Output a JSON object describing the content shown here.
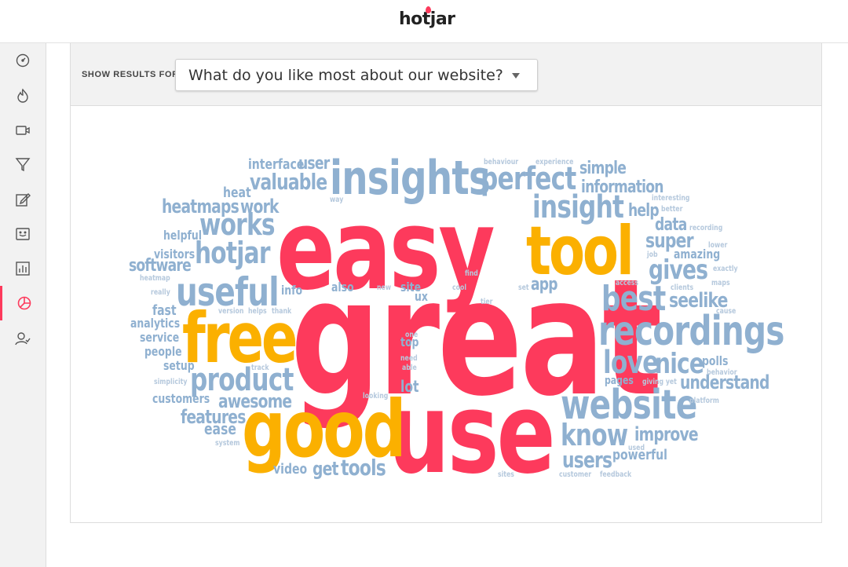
{
  "app": {
    "logo_text": "hotjar"
  },
  "sidebar": {
    "items": [
      {
        "name": "dashboard",
        "icon": "dashboard-gauge-icon",
        "active": false
      },
      {
        "name": "heatmaps",
        "icon": "flame-icon",
        "active": false
      },
      {
        "name": "recordings",
        "icon": "video-camera-icon",
        "active": false
      },
      {
        "name": "funnels",
        "icon": "funnel-icon",
        "active": false
      },
      {
        "name": "forms",
        "icon": "edit-form-icon",
        "active": false
      },
      {
        "name": "feedback",
        "icon": "feedback-face-icon",
        "active": false
      },
      {
        "name": "polls",
        "icon": "bar-chart-icon",
        "active": false
      },
      {
        "name": "surveys",
        "icon": "pie-chart-icon",
        "active": true
      },
      {
        "name": "recruiters",
        "icon": "user-check-icon",
        "active": false
      }
    ]
  },
  "filter": {
    "label": "SHOW RESULTS FOR:",
    "selected_question": "What do you like most about our website?"
  },
  "colors": {
    "accent": "#fd3a5c",
    "pink": "#fd3a5c",
    "orange": "#fbb000",
    "blue": "#8fb0d0",
    "lightblue": "#b6c9dd"
  },
  "word_cloud": {
    "words": [
      {
        "text": "great",
        "c": "pink"
      },
      {
        "text": "easy",
        "c": "pink"
      },
      {
        "text": "use",
        "c": "pink"
      },
      {
        "text": "good",
        "c": "orange"
      },
      {
        "text": "free",
        "c": "orange"
      },
      {
        "text": "tool",
        "c": "orange"
      },
      {
        "text": "insights",
        "c": "blue"
      },
      {
        "text": "perfect",
        "c": "blue"
      },
      {
        "text": "insight",
        "c": "blue"
      },
      {
        "text": "recordings",
        "c": "blue"
      },
      {
        "text": "website",
        "c": "blue"
      },
      {
        "text": "useful",
        "c": "blue"
      },
      {
        "text": "hotjar",
        "c": "blue"
      },
      {
        "text": "works",
        "c": "blue"
      },
      {
        "text": "product",
        "c": "blue"
      },
      {
        "text": "best",
        "c": "blue"
      },
      {
        "text": "love",
        "c": "blue"
      },
      {
        "text": "nice",
        "c": "blue"
      },
      {
        "text": "know",
        "c": "blue"
      },
      {
        "text": "gives",
        "c": "blue"
      },
      {
        "text": "super",
        "c": "blue"
      },
      {
        "text": "seelike",
        "c": "blue"
      },
      {
        "text": "valuable",
        "c": "blue"
      },
      {
        "text": "heatmaps",
        "c": "blue"
      },
      {
        "text": "work",
        "c": "blue"
      },
      {
        "text": "awesome",
        "c": "blue"
      },
      {
        "text": "features",
        "c": "blue"
      },
      {
        "text": "tools",
        "c": "blue"
      },
      {
        "text": "get",
        "c": "blue"
      },
      {
        "text": "users",
        "c": "blue"
      },
      {
        "text": "improve",
        "c": "blue"
      },
      {
        "text": "understand",
        "c": "blue"
      },
      {
        "text": "powerful",
        "c": "blue"
      },
      {
        "text": "information",
        "c": "blue"
      },
      {
        "text": "simple",
        "c": "blue"
      },
      {
        "text": "help",
        "c": "blue"
      },
      {
        "text": "data",
        "c": "blue"
      },
      {
        "text": "amazing",
        "c": "blue"
      },
      {
        "text": "app",
        "c": "blue"
      },
      {
        "text": "interface",
        "c": "blue"
      },
      {
        "text": "user",
        "c": "blue"
      },
      {
        "text": "heat",
        "c": "blue"
      },
      {
        "text": "helpful",
        "c": "blue"
      },
      {
        "text": "visitors",
        "c": "blue"
      },
      {
        "text": "software",
        "c": "blue"
      },
      {
        "text": "info",
        "c": "blue"
      },
      {
        "text": "also",
        "c": "blue"
      },
      {
        "text": "site",
        "c": "blue"
      },
      {
        "text": "ux",
        "c": "blue"
      },
      {
        "text": "fast",
        "c": "blue"
      },
      {
        "text": "analytics",
        "c": "blue"
      },
      {
        "text": "service",
        "c": "blue"
      },
      {
        "text": "people",
        "c": "blue"
      },
      {
        "text": "setup",
        "c": "blue"
      },
      {
        "text": "customers",
        "c": "blue"
      },
      {
        "text": "ease",
        "c": "blue"
      },
      {
        "text": "video",
        "c": "blue"
      },
      {
        "text": "lot",
        "c": "blue"
      },
      {
        "text": "top",
        "c": "blue"
      },
      {
        "text": "pages",
        "c": "blue"
      },
      {
        "text": "polls",
        "c": "blue"
      },
      {
        "text": "behaviour",
        "c": "lightblue"
      },
      {
        "text": "experience",
        "c": "lightblue"
      },
      {
        "text": "interesting",
        "c": "lightblue"
      },
      {
        "text": "better",
        "c": "lightblue"
      },
      {
        "text": "recording",
        "c": "lightblue"
      },
      {
        "text": "job",
        "c": "lightblue"
      },
      {
        "text": "lower",
        "c": "lightblue"
      },
      {
        "text": "exactly",
        "c": "lightblue"
      },
      {
        "text": "maps",
        "c": "lightblue"
      },
      {
        "text": "access",
        "c": "lightblue"
      },
      {
        "text": "clients",
        "c": "lightblue"
      },
      {
        "text": "cause",
        "c": "lightblue"
      },
      {
        "text": "way",
        "c": "lightblue"
      },
      {
        "text": "heatmap",
        "c": "lightblue"
      },
      {
        "text": "really",
        "c": "lightblue"
      },
      {
        "text": "version",
        "c": "lightblue"
      },
      {
        "text": "helps",
        "c": "lightblue"
      },
      {
        "text": "thank",
        "c": "lightblue"
      },
      {
        "text": "find",
        "c": "lightblue"
      },
      {
        "text": "new",
        "c": "lightblue"
      },
      {
        "text": "cool",
        "c": "lightblue"
      },
      {
        "text": "set",
        "c": "lightblue"
      },
      {
        "text": "tier",
        "c": "lightblue"
      },
      {
        "text": "one",
        "c": "lightblue"
      },
      {
        "text": "need",
        "c": "lightblue"
      },
      {
        "text": "able",
        "c": "lightblue"
      },
      {
        "text": "track",
        "c": "lightblue"
      },
      {
        "text": "simplicity",
        "c": "lightblue"
      },
      {
        "text": "looking",
        "c": "lightblue"
      },
      {
        "text": "giving yet",
        "c": "lightblue"
      },
      {
        "text": "behavior",
        "c": "lightblue"
      },
      {
        "text": "platform",
        "c": "lightblue"
      },
      {
        "text": "system",
        "c": "lightblue"
      },
      {
        "text": "used",
        "c": "lightblue"
      },
      {
        "text": "customer",
        "c": "lightblue"
      },
      {
        "text": "feedback",
        "c": "lightblue"
      },
      {
        "text": "sites",
        "c": "lightblue"
      }
    ]
  }
}
